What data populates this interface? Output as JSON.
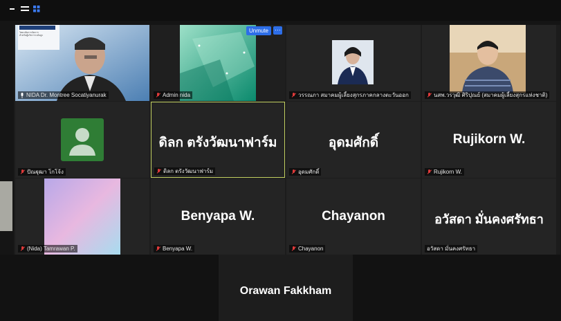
{
  "window": {
    "controls": [
      "minimize-icon",
      "fullscreen-icon",
      "gallery-view-icon"
    ]
  },
  "participants": [
    {
      "name": "NIDA Dr. Montree Socatiyanurak",
      "muted": false,
      "video": true
    },
    {
      "name": "Admin nida",
      "muted": true,
      "video": true
    },
    {
      "name": "วรรณภา สมาคมผู้เลี้ยงสุกรภาคกลางตะวันออก",
      "muted": true,
      "video": true
    },
    {
      "name": "นสพ.วรวุฒิ ศิริปุณย์ (สมาคมผู้เลี้ยงสุกรแห่งชาติ)",
      "muted": true,
      "video": true
    },
    {
      "name": "ปัณฐุฒา โกโจ้ง",
      "muted": true,
      "video": false
    },
    {
      "name": "ดิลก ตรังวัฒนาฟาร์ม",
      "label": "ดิลก ตรังวัฒนาฟาร์ม",
      "muted": true,
      "video": false,
      "active_speaker": true
    },
    {
      "name": "อุดมศักดิ์",
      "label": "อุดมศักดิ์",
      "muted": true,
      "video": false
    },
    {
      "name": "Rujikorn W.",
      "label": "Rujikorn W.",
      "muted": true,
      "video": false
    },
    {
      "name": "(Nida) Tamrawan P.",
      "muted": true,
      "video": true
    },
    {
      "name": "Benyapa W.",
      "label": "Benyapa W.",
      "muted": true,
      "video": false
    },
    {
      "name": "Chayanon",
      "label": "Chayanon",
      "muted": true,
      "video": false
    },
    {
      "name": "อวัสดา มั่นคงศรัทธา",
      "label": "อวัสดา มั่นคงศรัทธา",
      "muted": false,
      "video": false
    },
    {
      "name": "Orawan Fakkham",
      "muted": false,
      "video": false
    }
  ],
  "tile_overlay": {
    "unmute_label": "Unmute",
    "more_label": "···"
  },
  "slide": {
    "line1": "วิทยาลัยการจัดการ",
    "line2": "สำหรับผู้บริหารระดับสูง"
  },
  "colors": {
    "background": "#151515",
    "tile": "#242424",
    "active_border": "#c4d162",
    "button_blue": "#2d6ee8",
    "muted_red": "#e03a3a"
  }
}
